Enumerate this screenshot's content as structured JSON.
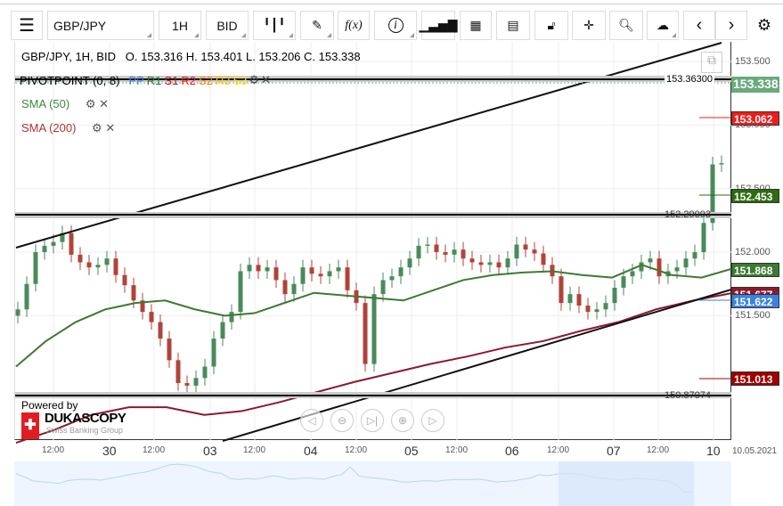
{
  "toolbar": {
    "symbol": "GBP/JPY",
    "timeframe": "1H",
    "side": "BID",
    "fx_label": "f(x)",
    "info_label": "i"
  },
  "ohlc_header": "GBP/JPY, 1H, BID   O. 153.316 H. 153.401 L. 153.206 C. 153.338",
  "indicators": {
    "pivot": "PIVOTPOINT (0, 8)",
    "pivot_levels": [
      {
        "label": "PP",
        "color": "#3b7dd8"
      },
      {
        "label": "R1",
        "color": "#2e7d32"
      },
      {
        "label": "S1",
        "color": "#b71c1c"
      },
      {
        "label": "R2",
        "color": "#ff1a1a"
      },
      {
        "label": "S2",
        "color": "#ff8c00"
      },
      {
        "label": "R3",
        "color": "#ffc400"
      },
      {
        "label": "S3",
        "color": "#ffe600"
      }
    ],
    "sma50": "SMA (50)",
    "sma200": "SMA (200)"
  },
  "lines": {
    "pivot_value": "153.36300",
    "upper_value": "152.29003",
    "lower_value": "150.87074"
  },
  "yaxis": {
    "ticks": [
      "153.500",
      "153.000",
      "152.500",
      "152.000",
      "151.500"
    ]
  },
  "price_tags": [
    {
      "value": "153.338",
      "color": "#6aaa7d"
    },
    {
      "value": "153.062",
      "color": "#ee1c1c"
    },
    {
      "value": "152.453",
      "color": "#2e6b12"
    },
    {
      "value": "151.868",
      "color": "#3d7a32"
    },
    {
      "value": "151.677",
      "color": "#8b1a2b"
    },
    {
      "value": "151.622",
      "color": "#3b82e0"
    },
    {
      "value": "151.013",
      "color": "#a00000"
    }
  ],
  "xaxis": {
    "labels": [
      "12:00",
      "30",
      "12:00",
      "03",
      "12:00",
      "04",
      "12:00",
      "05",
      "12:00",
      "06",
      "12:00",
      "07",
      "12:00",
      "10"
    ],
    "date": "10.05.2021"
  },
  "branding": {
    "powered": "Powered by",
    "name": "DUKASCOPY",
    "sub": "Swiss Banking Group"
  },
  "chart_data": {
    "type": "candlestick",
    "closes": [
      151.55,
      151.75,
      152.0,
      152.05,
      152.08,
      152.15,
      151.98,
      151.92,
      151.88,
      151.9,
      151.95,
      151.82,
      151.74,
      151.62,
      151.53,
      151.45,
      151.32,
      151.15,
      150.97,
      150.95,
      151.01,
      151.1,
      151.32,
      151.45,
      151.53,
      151.85,
      151.9,
      151.85,
      151.88,
      151.78,
      151.67,
      151.75,
      151.88,
      151.83,
      151.81,
      151.85,
      151.88,
      151.7,
      151.6,
      151.12,
      151.67,
      151.78,
      151.81,
      151.88,
      151.95,
      152.05,
      152.06,
      152.0,
      151.98,
      152.02,
      151.95,
      151.92,
      151.9,
      151.92,
      151.88,
      151.95,
      152.06,
      152.02,
      151.99,
      151.9,
      151.81,
      151.6,
      151.67,
      151.58,
      151.53,
      151.55,
      151.6,
      151.72,
      151.81,
      151.85,
      151.92,
      151.95,
      151.81,
      151.85,
      151.88,
      151.95,
      152.0,
      152.23,
      152.69,
      152.7
    ],
    "sma50": [
      151.1,
      151.3,
      151.45,
      151.55,
      151.6,
      151.62,
      151.55,
      151.5,
      151.52,
      151.6,
      151.68,
      151.66,
      151.64,
      151.62,
      151.7,
      151.78,
      151.82,
      151.84,
      151.85,
      151.82,
      151.8,
      151.9,
      151.82,
      151.8,
      151.868
    ],
    "sma200": [
      150.5,
      150.6,
      150.72,
      150.78,
      150.78,
      150.72,
      150.75,
      150.82,
      150.9,
      150.98,
      151.05,
      151.12,
      151.18,
      151.25,
      151.3,
      151.38,
      151.45,
      151.55,
      151.62,
      151.677
    ],
    "ylim": [
      150.6,
      153.7
    ]
  }
}
